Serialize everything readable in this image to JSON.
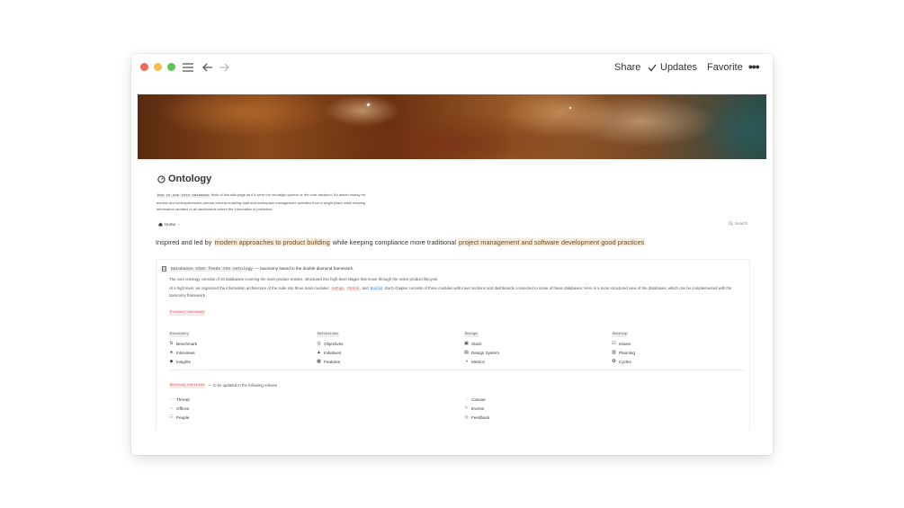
{
  "titlebar": {
    "share_label": "Share",
    "updates_label": "Updates",
    "favorite_label": "Favorite",
    "more_label": "•••"
  },
  "page": {
    "title": "Ontology",
    "intro_code": "How to use this database",
    "intro_text": " think of this wiki-page as if it were the neuralgic system or the core backend. It's aimed mainly for admins and workspace/work-stream owners enabling data and workspace management activities from a single place while keeping information updated in all dashboards where the information is published."
  },
  "breadcrumb": {
    "home_label": "Home",
    "chevron": "⌄"
  },
  "search": {
    "label": "Search"
  },
  "headline": {
    "part1": "Inspired and led by ",
    "hl1": "modern approaches to product building",
    "part2": " while keeping compliance more traditional ",
    "hl2": "project management and software development good practices"
  },
  "callout": {
    "head_code": "Databases that feeds the ontology",
    "head_text": " — taxonomy based in the double diamond framework.",
    "p1": "The core ontology consists of 20 databases covering the main product entities, structured into high-level stages that move through the entire product lifecycle.",
    "p2_a": "At a high level, we organized the information architecture of the suite into three main modules: ",
    "p2_setup": "setup",
    "p2_b": ", ",
    "p2_think": "think",
    "p2_c": ", and ",
    "p2_build": "build",
    "p2_d": ". Each chapter consists of three modules with inner sections and dashboards connected to some of these databases. Here is a more structured view of the databases, which can be complemented with the taxonomy framework."
  },
  "taxonomy": {
    "label": "Product taxonomy",
    "columns": [
      {
        "header": "Discovery",
        "items": [
          "Benchmark",
          "Interviews",
          "Insights"
        ]
      },
      {
        "header": "Definition",
        "items": [
          "Objectives",
          "Initiatives",
          "Features"
        ]
      },
      {
        "header": "Design",
        "items": [
          "Stack",
          "Design System",
          "Metrics"
        ]
      },
      {
        "header": "Develop",
        "items": [
          "Issues",
          "Planning",
          "Cycles"
        ]
      }
    ]
  },
  "working": {
    "label": "Working entities",
    "suffix": "— to be updated in the following release",
    "left": [
      "Thread",
      "Offices",
      "People"
    ],
    "right": [
      "Canvas",
      "Events",
      "Feedback"
    ]
  }
}
